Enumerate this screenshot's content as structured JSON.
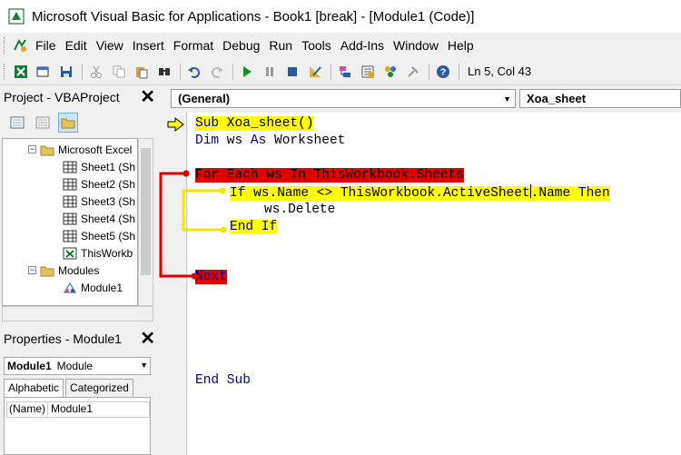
{
  "window": {
    "title": "Microsoft Visual Basic for Applications - Book1 [break] - [Module1 (Code)]"
  },
  "menu": {
    "items": [
      "File",
      "Edit",
      "View",
      "Insert",
      "Format",
      "Debug",
      "Run",
      "Tools",
      "Add-Ins",
      "Window",
      "Help"
    ]
  },
  "toolbar": {
    "cursor_position": "Ln 5, Col 43"
  },
  "project": {
    "title": "Project - VBAProject",
    "tree": [
      {
        "label": "Microsoft Excel",
        "level": 1
      },
      {
        "label": "Sheet1 (Sh",
        "level": 2
      },
      {
        "label": "Sheet2 (Sh",
        "level": 2
      },
      {
        "label": "Sheet3 (Sh",
        "level": 2
      },
      {
        "label": "Sheet4 (Sh",
        "level": 2
      },
      {
        "label": "Sheet5 (Sh",
        "level": 2
      },
      {
        "label": "ThisWorkb",
        "level": 2
      },
      {
        "label": "Modules",
        "level": 1
      },
      {
        "label": "Module1",
        "level": 2
      }
    ]
  },
  "properties": {
    "title": "Properties - Module1",
    "object_name": "Module1",
    "object_type": "Module",
    "tabs": [
      "Alphabetic",
      "Categorized"
    ],
    "rows": [
      {
        "key": "(Name)",
        "value": "Module1"
      }
    ]
  },
  "code": {
    "object_combo": "(General)",
    "proc_combo": "Xoa_sheet",
    "lines": {
      "l1_kw": "Sub",
      "l1_rest": " Xoa_sheet()",
      "l2_kw1": "Dim",
      "l2_mid": " ws ",
      "l2_kw2": "As",
      "l2_rest": " Worksheet",
      "l3": "For Each ws In ThisWorkbook.Sheets",
      "l4_kw": "If",
      "l4_mid": " ws.Name <> ThisWorkbook.ActiveSheet",
      "l4_after": ".Name ",
      "l4_kw2": "Then",
      "l5": "ws.Delete",
      "l6": "End If",
      "l7": "Next",
      "l8": "End Sub"
    }
  },
  "colors": {
    "keyword": "#00008b",
    "highlight_yellow": "#ffff00",
    "highlight_red": "#e00000",
    "connector_red": "#e00000",
    "connector_yellow": "#f2e600"
  }
}
